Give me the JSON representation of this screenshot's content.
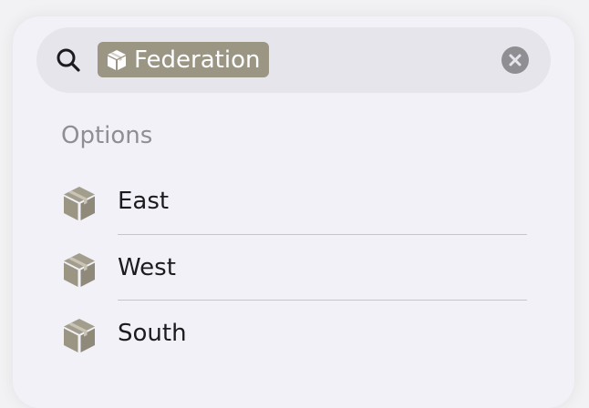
{
  "search": {
    "token_label": "Federation",
    "token_color": "#9b9584"
  },
  "options": {
    "header": "Options",
    "items": [
      {
        "label": "East",
        "icon": "box-icon"
      },
      {
        "label": "West",
        "icon": "box-icon"
      },
      {
        "label": "South",
        "icon": "box-icon"
      }
    ]
  },
  "colors": {
    "panel": "#f2f1f7",
    "search_bar": "#e6e5eb",
    "icon": "#9b9584",
    "secondary_text": "#8e8e93"
  }
}
